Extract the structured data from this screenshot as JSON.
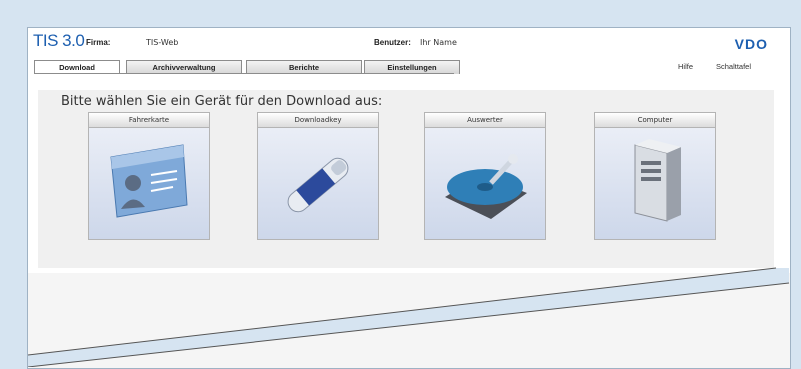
{
  "header": {
    "app_title": "TIS 3.0",
    "firma_label": "Firma:",
    "firma_value": "TIS-Web",
    "user_label": "Benutzer:",
    "user_value": "Ihr Name",
    "brand": "VDO"
  },
  "tabs": [
    {
      "label": "Download"
    },
    {
      "label": "Archivverwaltung"
    },
    {
      "label": "Berichte"
    },
    {
      "label": "Einstellungen"
    }
  ],
  "links": {
    "help": "Hilfe",
    "dashboard": "Schalttafel"
  },
  "main": {
    "prompt": "Bitte wählen Sie ein Gerät für den Download aus:",
    "devices": [
      {
        "label": "Fahrerkarte",
        "icon": "driver-card-icon"
      },
      {
        "label": "Downloadkey",
        "icon": "usb-key-icon"
      },
      {
        "label": "Auswerter",
        "icon": "hard-drive-icon"
      },
      {
        "label": "Computer",
        "icon": "computer-icon"
      }
    ]
  },
  "colors": {
    "accent": "#1d5fb0",
    "background": "#d6e4f1"
  }
}
